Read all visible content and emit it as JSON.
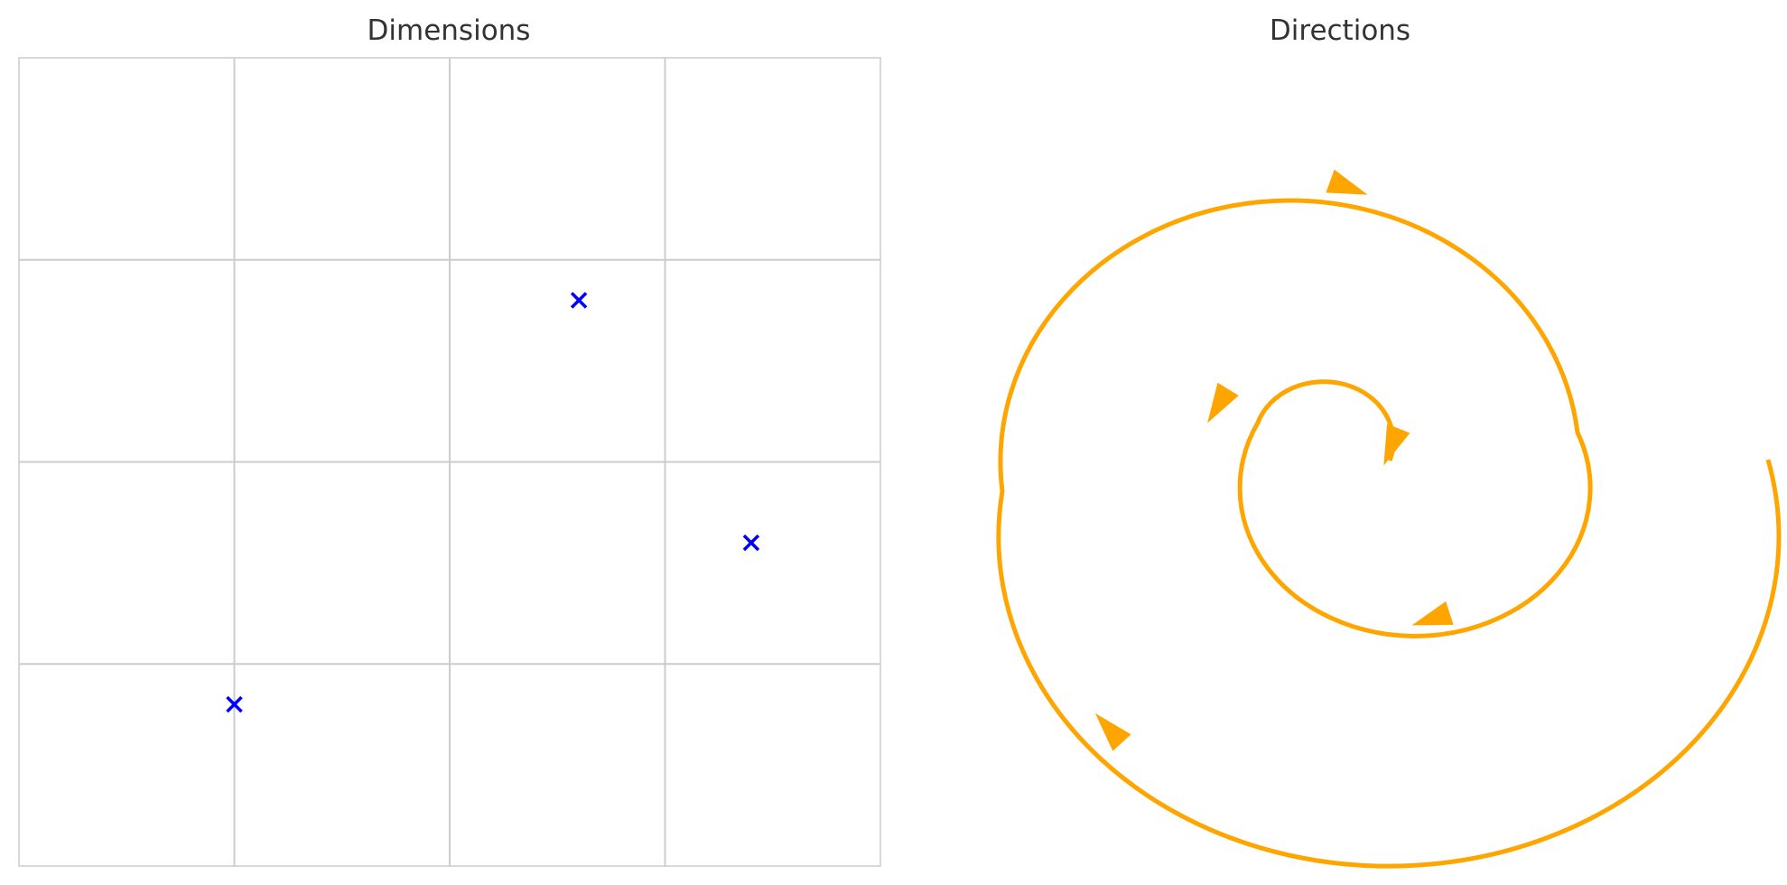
{
  "chart_data": [
    {
      "type": "scatter",
      "title": "Dimensions",
      "xlim": [
        0,
        4
      ],
      "ylim": [
        0,
        4
      ],
      "grid": true,
      "marker": "x",
      "marker_color": "#0000ff",
      "points": [
        {
          "x": 2.6,
          "y": 2.8
        },
        {
          "x": 3.4,
          "y": 1.6
        },
        {
          "x": 1.0,
          "y": 0.8
        }
      ]
    },
    {
      "type": "line",
      "title": "Directions",
      "description_kind": "spiral-with-arrows",
      "line_color": "#ffa500",
      "arrow_count": 6,
      "turns": 2.5
    }
  ]
}
